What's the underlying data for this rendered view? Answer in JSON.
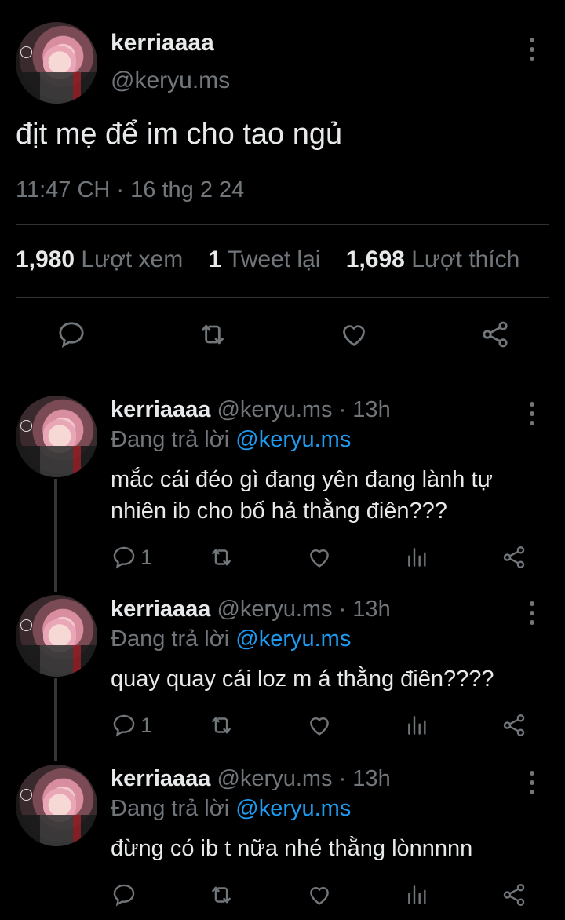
{
  "main_tweet": {
    "display_name": "kerriaaaa",
    "handle": "@keryu.ms",
    "text": "địt mẹ để im cho tao ngủ",
    "timestamp": "11:47 CH · 16 thg 2 24",
    "stats": {
      "views_count": "1,980",
      "views_label": "Lượt xem",
      "retweets_count": "1",
      "retweets_label": "Tweet lại",
      "likes_count": "1,698",
      "likes_label": "Lượt thích"
    },
    "actions": [
      "reply-icon",
      "retweet-icon",
      "like-icon",
      "share-icon"
    ]
  },
  "replies": [
    {
      "display_name": "kerriaaaa",
      "handle": "@keryu.ms · 13h",
      "replying_prefix": "Đang trả lời",
      "replying_to": "@keryu.ms",
      "text": "mắc cái đéo gì đang yên đang lành tự nhiên ib cho bố hả thằng điên???",
      "reply_count": "1"
    },
    {
      "display_name": "kerriaaaa",
      "handle": "@keryu.ms · 13h",
      "replying_prefix": "Đang trả lời",
      "replying_to": "@keryu.ms",
      "text": "quay quay cái loz m á thằng điên????",
      "reply_count": "1"
    },
    {
      "display_name": "kerriaaaa",
      "handle": "@keryu.ms · 13h",
      "replying_prefix": "Đang trả lời",
      "replying_to": "@keryu.ms",
      "text": "đừng có ib t nữa nhé thằng lònnnnn",
      "reply_count": ""
    }
  ],
  "colors": {
    "background": "#000000",
    "text_primary": "#e7e9ea",
    "text_secondary": "#71767b",
    "link": "#1d9bf0",
    "divider": "#2f3336"
  }
}
